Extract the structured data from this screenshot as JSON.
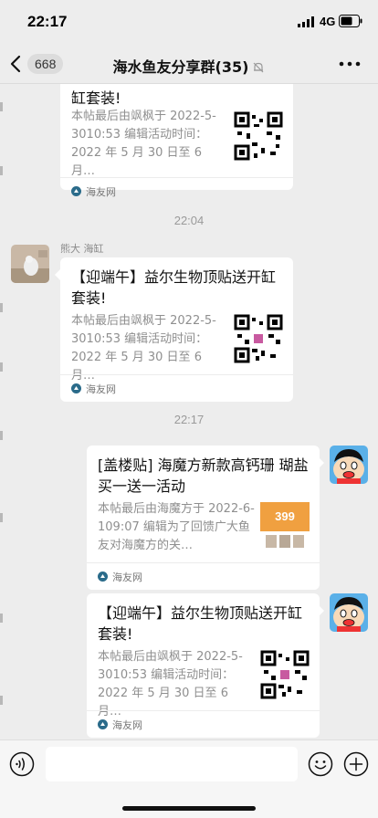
{
  "status_bar": {
    "time": "22:17",
    "network": "4G"
  },
  "header": {
    "unread_count": "668",
    "title": "海水鱼友分享群(35)"
  },
  "time_dividers": [
    "22:04",
    "22:17"
  ],
  "messages": [
    {
      "sender": "",
      "title": "缸套装!",
      "desc": "本帖最后由飒枫于 2022-5-3010:53 编辑活动时间：2022 年 5 月 30 日至 6 月…",
      "source": "海友网",
      "thumb": "qr-code"
    },
    {
      "sender": "熊大 海缸",
      "title": "【迎端午】益尔生物顶贴送开缸套装!",
      "desc": "本帖最后由飒枫于 2022-5-3010:53 编辑活动时间：2022 年 5 月 30 日至 6 月…",
      "source": "海友网",
      "thumb": "qr-code"
    },
    {
      "sender": "",
      "title": "[盖楼贴] 海魔方新款高钙珊 瑚盐买一送一活动",
      "desc": "本帖最后由海魔方于 2022-6-109:07 编辑为了回馈广大鱼友对海魔方的关…",
      "source": "海友网",
      "thumb": "product-photo",
      "thumb_text": "399"
    },
    {
      "sender": "",
      "title": "【迎端午】益尔生物顶贴送开缸套装!",
      "desc": "本帖最后由飒枫于 2022-5-3010:53 编辑活动时间：2022 年 5 月 30 日至 6 月…",
      "source": "海友网",
      "thumb": "qr-code"
    }
  ],
  "colors": {
    "background": "#ededed",
    "card": "#ffffff",
    "meta_text": "#8f8f8f",
    "thumb_orange": "#f0a040"
  }
}
